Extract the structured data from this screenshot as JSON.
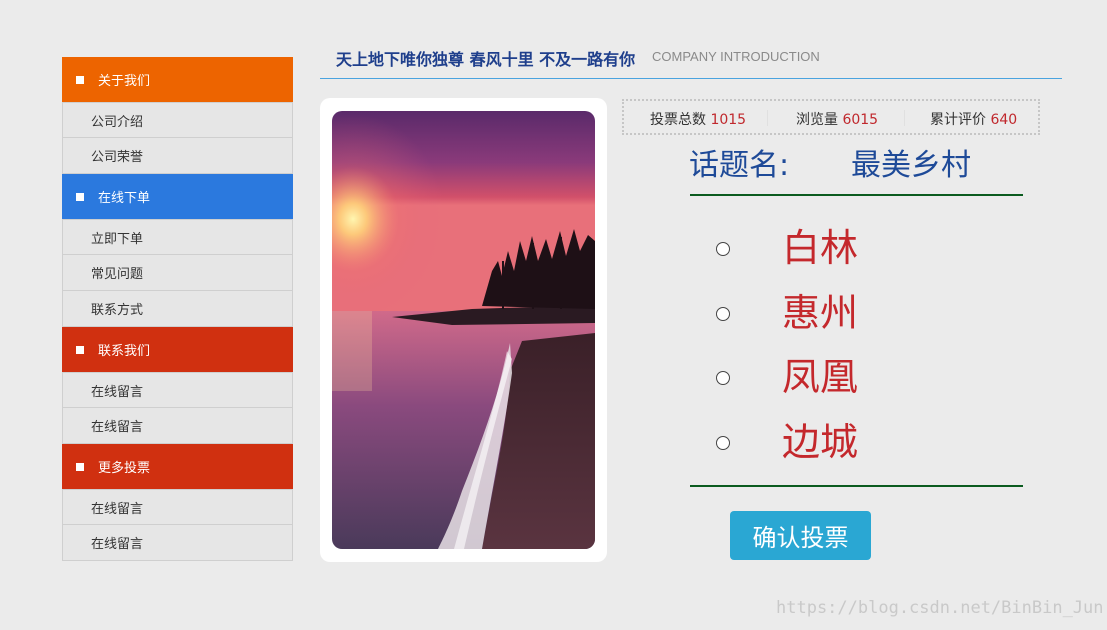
{
  "colors": {
    "orange": "#ed6400",
    "blue": "#2b79de",
    "red": "#d03010",
    "accent_line": "#4aa3df",
    "option_red": "#c4282c",
    "title_blue": "#1e4a98",
    "button": "#2aa7d3"
  },
  "sidebar": {
    "sections": [
      {
        "label": "关于我们",
        "color": "#ed6400",
        "items": [
          "公司介绍",
          "公司荣誉"
        ]
      },
      {
        "label": "在线下单",
        "color": "#2b79de",
        "items": [
          "立即下单",
          "常见问题",
          "联系方式"
        ]
      },
      {
        "label": "联系我们",
        "color": "#d03010",
        "items": [
          "在线留言",
          "在线留言"
        ]
      },
      {
        "label": "更多投票",
        "color": "#d03010",
        "items": [
          "在线留言",
          "在线留言"
        ]
      }
    ]
  },
  "header": {
    "title": "天上地下唯你独尊 春风十里 不及一路有你",
    "subtitle": "COMPANY INTRODUCTION"
  },
  "stats": {
    "votes_label": "投票总数",
    "votes_value": "1015",
    "views_label": "浏览量",
    "views_value": "6015",
    "reviews_label": "累计评价",
    "reviews_value": "640"
  },
  "topic": {
    "label": "话题名:",
    "name": "最美乡村"
  },
  "options": [
    "白林",
    "惠州",
    "凤凰",
    "边城"
  ],
  "confirm_label": "确认投票",
  "watermark": "https://blog.csdn.net/BinBin_Jun"
}
